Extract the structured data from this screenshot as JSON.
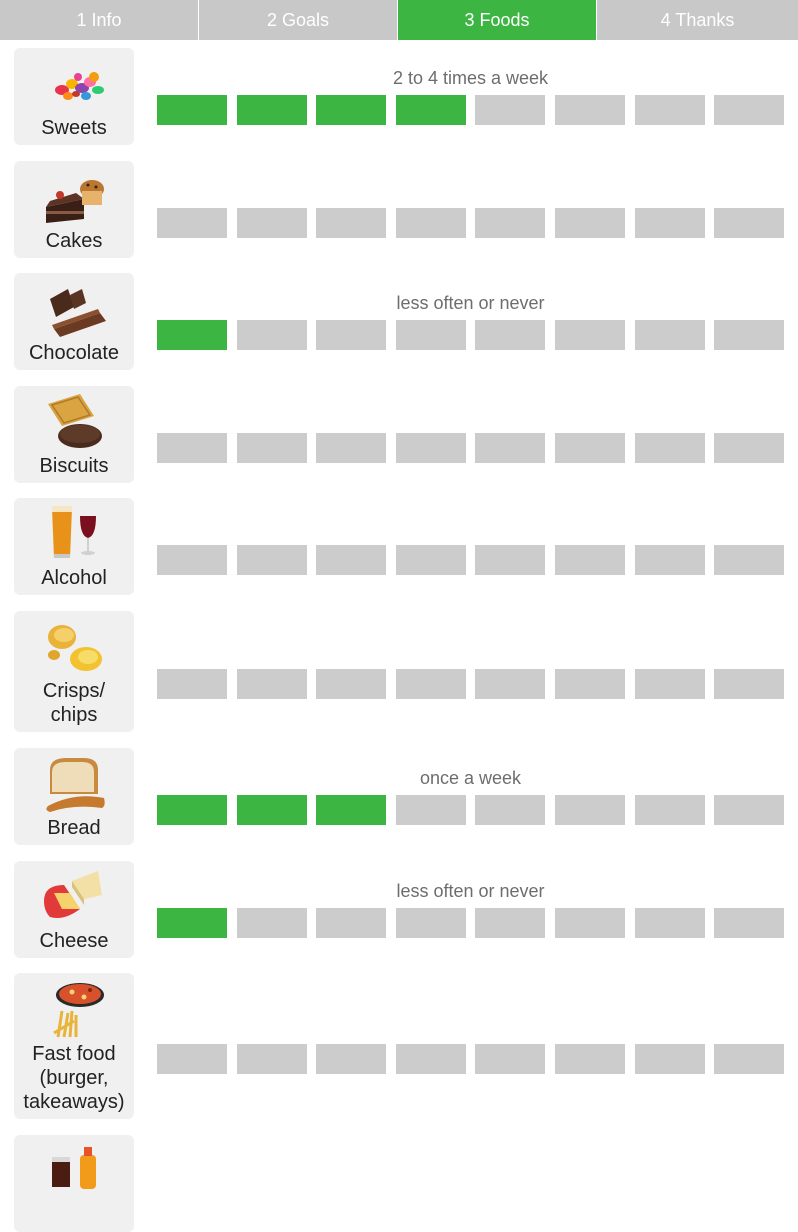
{
  "tabs": [
    {
      "label": "1 Info",
      "active": false
    },
    {
      "label": "2 Goals",
      "active": false
    },
    {
      "label": "3 Foods",
      "active": true
    },
    {
      "label": "4 Thanks",
      "active": false
    }
  ],
  "colors": {
    "active": "#3db543",
    "inactive": "#cccccc",
    "tab_inactive": "#c8c8c8",
    "card_bg": "#f0f0f0"
  },
  "scale_steps": 8,
  "foods": [
    {
      "name": "Sweets",
      "icon": "sweets-image",
      "frequency": "2 to 4 times a week",
      "filled": 4
    },
    {
      "name": "Cakes",
      "icon": "cake-image",
      "frequency": "",
      "filled": 0
    },
    {
      "name": "Chocolate",
      "icon": "chocolate-image",
      "frequency": "less often or never",
      "filled": 1
    },
    {
      "name": "Biscuits",
      "icon": "biscuits-image",
      "frequency": "",
      "filled": 0
    },
    {
      "name": "Alcohol",
      "icon": "alcohol-image",
      "frequency": "",
      "filled": 0
    },
    {
      "name": "Crisps/\nchips",
      "icon": "crisps-image",
      "frequency": "",
      "filled": 0
    },
    {
      "name": "Bread",
      "icon": "bread-image",
      "frequency": "once a week",
      "filled": 3
    },
    {
      "name": "Cheese",
      "icon": "cheese-image",
      "frequency": "less often or never",
      "filled": 1
    },
    {
      "name": "Fast food\n(burger,\ntakeaways)",
      "icon": "fast-food-image",
      "frequency": "",
      "filled": 0
    },
    {
      "name": "",
      "icon": "soft-drinks-image",
      "frequency": "",
      "filled": 0
    }
  ]
}
